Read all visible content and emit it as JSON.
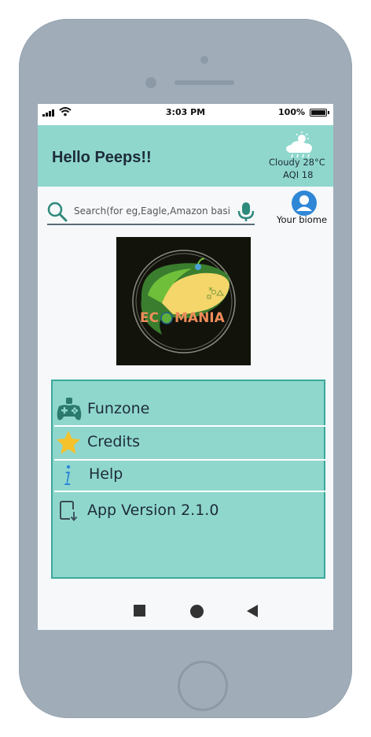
{
  "status": {
    "time": "3:03 PM",
    "battery": "100%"
  },
  "header": {
    "greeting": "Hello Peeps!!",
    "weather": {
      "condition": "Cloudy",
      "temperature": "28°C",
      "aqi": "AQI 18",
      "icon": "cloud-rain-sun-icon"
    }
  },
  "search": {
    "placeholder": "Search(for eg,Eagle,Amazon basin)",
    "value": ""
  },
  "profile": {
    "label": "Your biome"
  },
  "logo": {
    "text": "ECO MANIA"
  },
  "menu": {
    "items": [
      {
        "label": "Funzone",
        "icon": "gamepad-icon"
      },
      {
        "label": "Credits",
        "icon": "star-icon"
      },
      {
        "label": "Help",
        "icon": "info-icon"
      },
      {
        "label": "App Version 2.1.0",
        "icon": "app-update-icon"
      }
    ]
  },
  "colors": {
    "accent": "#8fd7cd",
    "border": "#3ba99a",
    "text": "#1d2b3a",
    "avatar": "#2f87d6",
    "star": "#f5c22b"
  }
}
